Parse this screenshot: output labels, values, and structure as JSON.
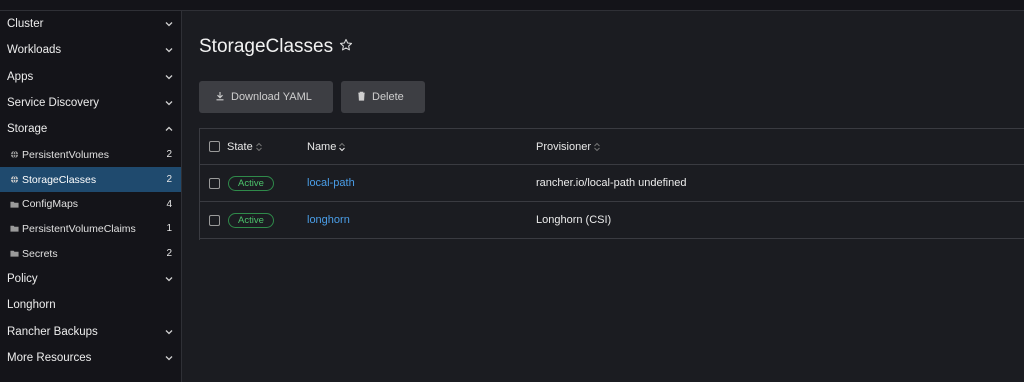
{
  "sidebar": {
    "groups": [
      {
        "label": "Cluster",
        "icon": "chevron-down-icon"
      },
      {
        "label": "Workloads",
        "icon": "chevron-down-icon"
      },
      {
        "label": "Apps",
        "icon": "chevron-down-icon"
      },
      {
        "label": "Service Discovery",
        "icon": "chevron-down-icon"
      },
      {
        "label": "Storage",
        "icon": "chevron-up-icon"
      }
    ],
    "storage_items": [
      {
        "label": "PersistentVolumes",
        "count": "2",
        "icon": "globe-icon"
      },
      {
        "label": "StorageClasses",
        "count": "2",
        "icon": "globe-icon",
        "active": true
      },
      {
        "label": "ConfigMaps",
        "count": "4",
        "icon": "folder-icon"
      },
      {
        "label": "PersistentVolumeClaims",
        "count": "1",
        "icon": "folder-icon"
      },
      {
        "label": "Secrets",
        "count": "2",
        "icon": "folder-icon"
      }
    ],
    "groups_after": [
      {
        "label": "Policy",
        "icon": "chevron-down-icon"
      },
      {
        "label": "Longhorn",
        "icon": ""
      },
      {
        "label": "Rancher Backups",
        "icon": "chevron-down-icon"
      },
      {
        "label": "More Resources",
        "icon": "chevron-down-icon"
      }
    ]
  },
  "page": {
    "title": "StorageClasses",
    "star_icon": "star-outline-icon"
  },
  "toolbar": {
    "download_label": "Download YAML",
    "delete_label": "Delete"
  },
  "table": {
    "columns": [
      "State",
      "Name",
      "Provisioner"
    ],
    "rows": [
      {
        "state": "Active",
        "name": "local-path",
        "provisioner": "rancher.io/local-path undefined"
      },
      {
        "state": "Active",
        "name": "longhorn",
        "provisioner": "Longhorn (CSI)"
      }
    ]
  },
  "colors": {
    "accent": "#1f4a6e",
    "link": "#4a9ee8",
    "active_badge": "#4cc26b"
  }
}
